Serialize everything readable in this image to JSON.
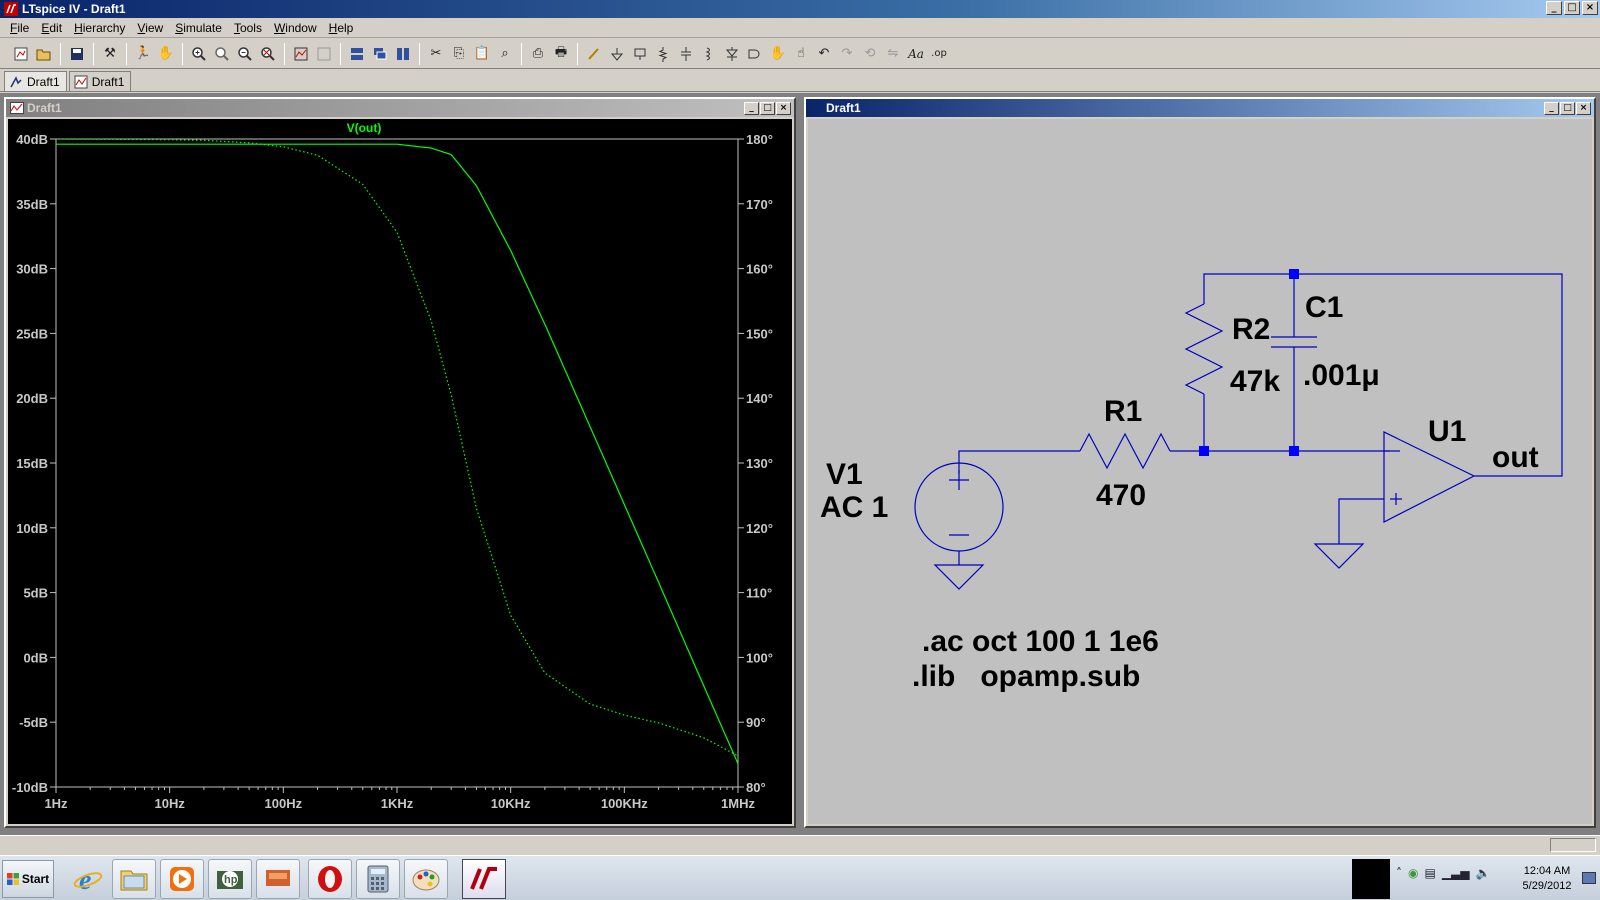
{
  "window": {
    "title": "LTspice IV - Draft1",
    "controls": [
      "_",
      "□",
      "×"
    ]
  },
  "menu": [
    "File",
    "Edit",
    "Hierarchy",
    "View",
    "Simulate",
    "Tools",
    "Window",
    "Help"
  ],
  "toolbar_icons": [
    "new-schematic-icon",
    "open-icon",
    "save-icon",
    "control-panel-icon",
    "run-icon",
    "halt-icon",
    "zoom-in-icon",
    "zoom-extents-icon",
    "zoom-out-icon",
    "zoom-cancel-icon",
    "autorange-icon",
    "plot-settings-icon",
    "tile-horizontal-icon",
    "cascade-icon",
    "tile-vertical-icon",
    "cut-icon",
    "copy-icon",
    "paste-icon",
    "find-icon",
    "print-setup-icon",
    "print-icon",
    "wire-icon",
    "ground-icon",
    "label-net-icon",
    "resistor-icon",
    "capacitor-icon",
    "inductor-icon",
    "diode-icon",
    "component-icon",
    "move-icon",
    "drag-icon",
    "undo-icon",
    "redo-icon",
    "rotate-icon",
    "mirror-icon",
    "text-icon",
    "spice-directive-icon"
  ],
  "tabs": [
    {
      "label": "Draft1",
      "kind": "schematic"
    },
    {
      "label": "Draft1",
      "kind": "waveform"
    }
  ],
  "plot_window": {
    "title": "Draft1"
  },
  "schematic_window": {
    "title": "Draft1"
  },
  "chart_data": {
    "type": "line",
    "title": "V(out)",
    "xlabel": "",
    "ylabel": "",
    "x_scale": "log",
    "x_ticks": [
      "1Hz",
      "10Hz",
      "100Hz",
      "1KHz",
      "10KHz",
      "100KHz",
      "1MHz"
    ],
    "x_range_hz": [
      1,
      1000000
    ],
    "y_left_ticks": [
      "40dB",
      "35dB",
      "30dB",
      "25dB",
      "20dB",
      "15dB",
      "10dB",
      "5dB",
      "0dB",
      "-5dB",
      "-10dB"
    ],
    "y_left_range": [
      -10,
      40
    ],
    "y_right_ticks": [
      "180°",
      "170°",
      "160°",
      "150°",
      "140°",
      "130°",
      "120°",
      "110°",
      "100°",
      "90°",
      "80°"
    ],
    "y_right_range": [
      80,
      180
    ],
    "series": [
      {
        "name": "V(out)",
        "style": "solid",
        "color": "#00ff00",
        "axis": "left",
        "unit": "dB",
        "x_hz": [
          1,
          100,
          1000,
          2000,
          3000,
          5000,
          10000,
          20000,
          50000,
          100000,
          200000,
          500000,
          1000000
        ],
        "y": [
          39.6,
          39.6,
          39.6,
          39.3,
          38.8,
          36.4,
          31.4,
          25.7,
          17.8,
          11.8,
          5.8,
          -2.2,
          -8.2
        ]
      },
      {
        "name": "",
        "style": "dotted",
        "color": "#00ff00",
        "axis": "right",
        "unit": "deg",
        "x_hz": [
          1,
          10,
          20,
          50,
          100,
          200,
          500,
          1000,
          2000,
          3000,
          5000,
          10000,
          20000,
          50000,
          100000,
          200000,
          500000,
          1000000
        ],
        "y": [
          180,
          179.9,
          179.8,
          179.4,
          178.8,
          177.5,
          173.0,
          165.6,
          151.9,
          140.5,
          123.0,
          106.5,
          97.6,
          92.8,
          91.1,
          89.9,
          87.6,
          84.8
        ]
      }
    ]
  },
  "schematic": {
    "labels": {
      "v1_name": "V1",
      "v1_value": "AC 1",
      "r1_name": "R1",
      "r1_value": "470",
      "r2_name": "R2",
      "r2_value": "47k",
      "c1_name": "C1",
      "c1_value": ".001μ",
      "u1_name": "U1",
      "net_out": "out",
      "directive_ac": ".ac oct 100 1 1e6",
      "directive_lib": ".lib   opamp.sub"
    },
    "colors": {
      "wire": "#0000c0",
      "junction": "#0000ff",
      "text": "#000000"
    }
  },
  "taskbar": {
    "start_label": "Start",
    "icons": [
      "internet-explorer-icon",
      "file-explorer-icon",
      "media-player-icon",
      "hp-icon",
      "presentation-icon",
      "opera-icon",
      "calculator-icon",
      "paint-icon",
      "ltspice-icon"
    ],
    "clock_time": "12:04 AM",
    "clock_date": "5/29/2012"
  }
}
